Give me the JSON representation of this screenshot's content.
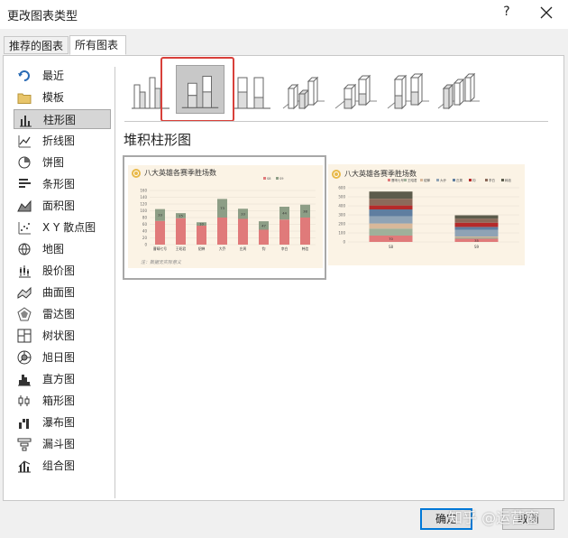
{
  "window": {
    "title": "更改图表类型",
    "help_label": "?"
  },
  "tabs": [
    {
      "label": "推荐的图表",
      "active": false
    },
    {
      "label": "所有图表",
      "active": true
    }
  ],
  "sidebar": {
    "selected": "柱形图",
    "items": [
      {
        "label": "最近",
        "icon": "undo-icon"
      },
      {
        "label": "模板",
        "icon": "folder-icon"
      },
      {
        "label": "柱形图",
        "icon": "column-chart-icon"
      },
      {
        "label": "折线图",
        "icon": "line-chart-icon"
      },
      {
        "label": "饼图",
        "icon": "pie-chart-icon"
      },
      {
        "label": "条形图",
        "icon": "bar-chart-icon"
      },
      {
        "label": "面积图",
        "icon": "area-chart-icon"
      },
      {
        "label": "X Y 散点图",
        "icon": "scatter-chart-icon"
      },
      {
        "label": "地图",
        "icon": "map-chart-icon"
      },
      {
        "label": "股价图",
        "icon": "stock-chart-icon"
      },
      {
        "label": "曲面图",
        "icon": "surface-chart-icon"
      },
      {
        "label": "雷达图",
        "icon": "radar-chart-icon"
      },
      {
        "label": "树状图",
        "icon": "treemap-chart-icon"
      },
      {
        "label": "旭日图",
        "icon": "sunburst-chart-icon"
      },
      {
        "label": "直方图",
        "icon": "histogram-chart-icon"
      },
      {
        "label": "箱形图",
        "icon": "box-whisker-chart-icon"
      },
      {
        "label": "瀑布图",
        "icon": "waterfall-chart-icon"
      },
      {
        "label": "漏斗图",
        "icon": "funnel-chart-icon"
      },
      {
        "label": "组合图",
        "icon": "combo-chart-icon"
      }
    ]
  },
  "subtypes": [
    {
      "name": "clustered-column",
      "selected": false
    },
    {
      "name": "stacked-column",
      "selected": true
    },
    {
      "name": "100-percent-stacked-column",
      "selected": false
    },
    {
      "name": "3d-clustered-column",
      "selected": false
    },
    {
      "name": "3d-stacked-column",
      "selected": false
    },
    {
      "name": "3d-100-percent-stacked-column",
      "selected": false
    },
    {
      "name": "3d-column",
      "selected": false
    }
  ],
  "chart_type_title": "堆积柱形图",
  "previews": [
    {
      "title": "八大英雄各赛季胜场数",
      "note": "注：数据无实际意义",
      "legend": [
        "S8",
        "S9"
      ],
      "chart_data": {
        "type": "bar",
        "stacked": true,
        "categories": [
          "曹晴七号",
          "王昭君",
          "貂蝉",
          "大乔",
          "庄周",
          "钧",
          "李白",
          "韩信"
        ],
        "series": [
          {
            "name": "S8",
            "values": [
              70,
              78,
              56,
              80,
              76,
              44,
              74,
              80
            ]
          },
          {
            "name": "S9",
            "values": [
              35,
              15,
              10,
              55,
              30,
              25,
              38,
              38
            ]
          }
        ],
        "data_labels": {
          "S9": [
            "33",
            "15",
            "10",
            "73",
            "33",
            "47",
            "44",
            "38"
          ]
        },
        "yticks": [
          "160",
          "140",
          "120",
          "100",
          "80",
          "60",
          "40",
          "20",
          "0"
        ],
        "ylim": [
          0,
          160
        ],
        "colors": {
          "S8": "#e07a7a",
          "S9": "#8d9e86"
        }
      }
    },
    {
      "title": "八大英雄各赛季胜场数",
      "legend": [
        "曹晴七号",
        "王昭君",
        "貂蝉",
        "大乔",
        "庄周",
        "钧",
        "李白",
        "韩信"
      ],
      "chart_data": {
        "type": "bar",
        "stacked": true,
        "categories": [
          "S8",
          "S9"
        ],
        "series": [
          {
            "name": "曹晴七号",
            "values": [
              70,
              35
            ]
          },
          {
            "name": "王昭君",
            "values": [
              78,
              15
            ]
          },
          {
            "name": "貂蝉",
            "values": [
              56,
              10
            ]
          },
          {
            "name": "大乔",
            "values": [
              80,
              73
            ]
          },
          {
            "name": "庄周",
            "values": [
              76,
              33
            ]
          },
          {
            "name": "钧",
            "values": [
              44,
              47
            ]
          },
          {
            "name": "李白",
            "values": [
              74,
              44
            ]
          },
          {
            "name": "韩信",
            "values": [
              80,
              38
            ]
          }
        ],
        "data_labels": {
          "曹晴七号": [
            "70",
            "35"
          ]
        },
        "yticks": [
          "600",
          "500",
          "400",
          "300",
          "200",
          "100",
          "0"
        ],
        "ylim": [
          0,
          600
        ],
        "colors": [
          "#e07a7a",
          "#9fb09a",
          "#d8b89a",
          "#8fa3b5",
          "#5f7ea0",
          "#b52a2a",
          "#8c6a5a",
          "#5c5c4c"
        ]
      }
    }
  ],
  "buttons": {
    "ok": "确定",
    "cancel": "取消"
  },
  "watermark": "知乎 @运营窗"
}
